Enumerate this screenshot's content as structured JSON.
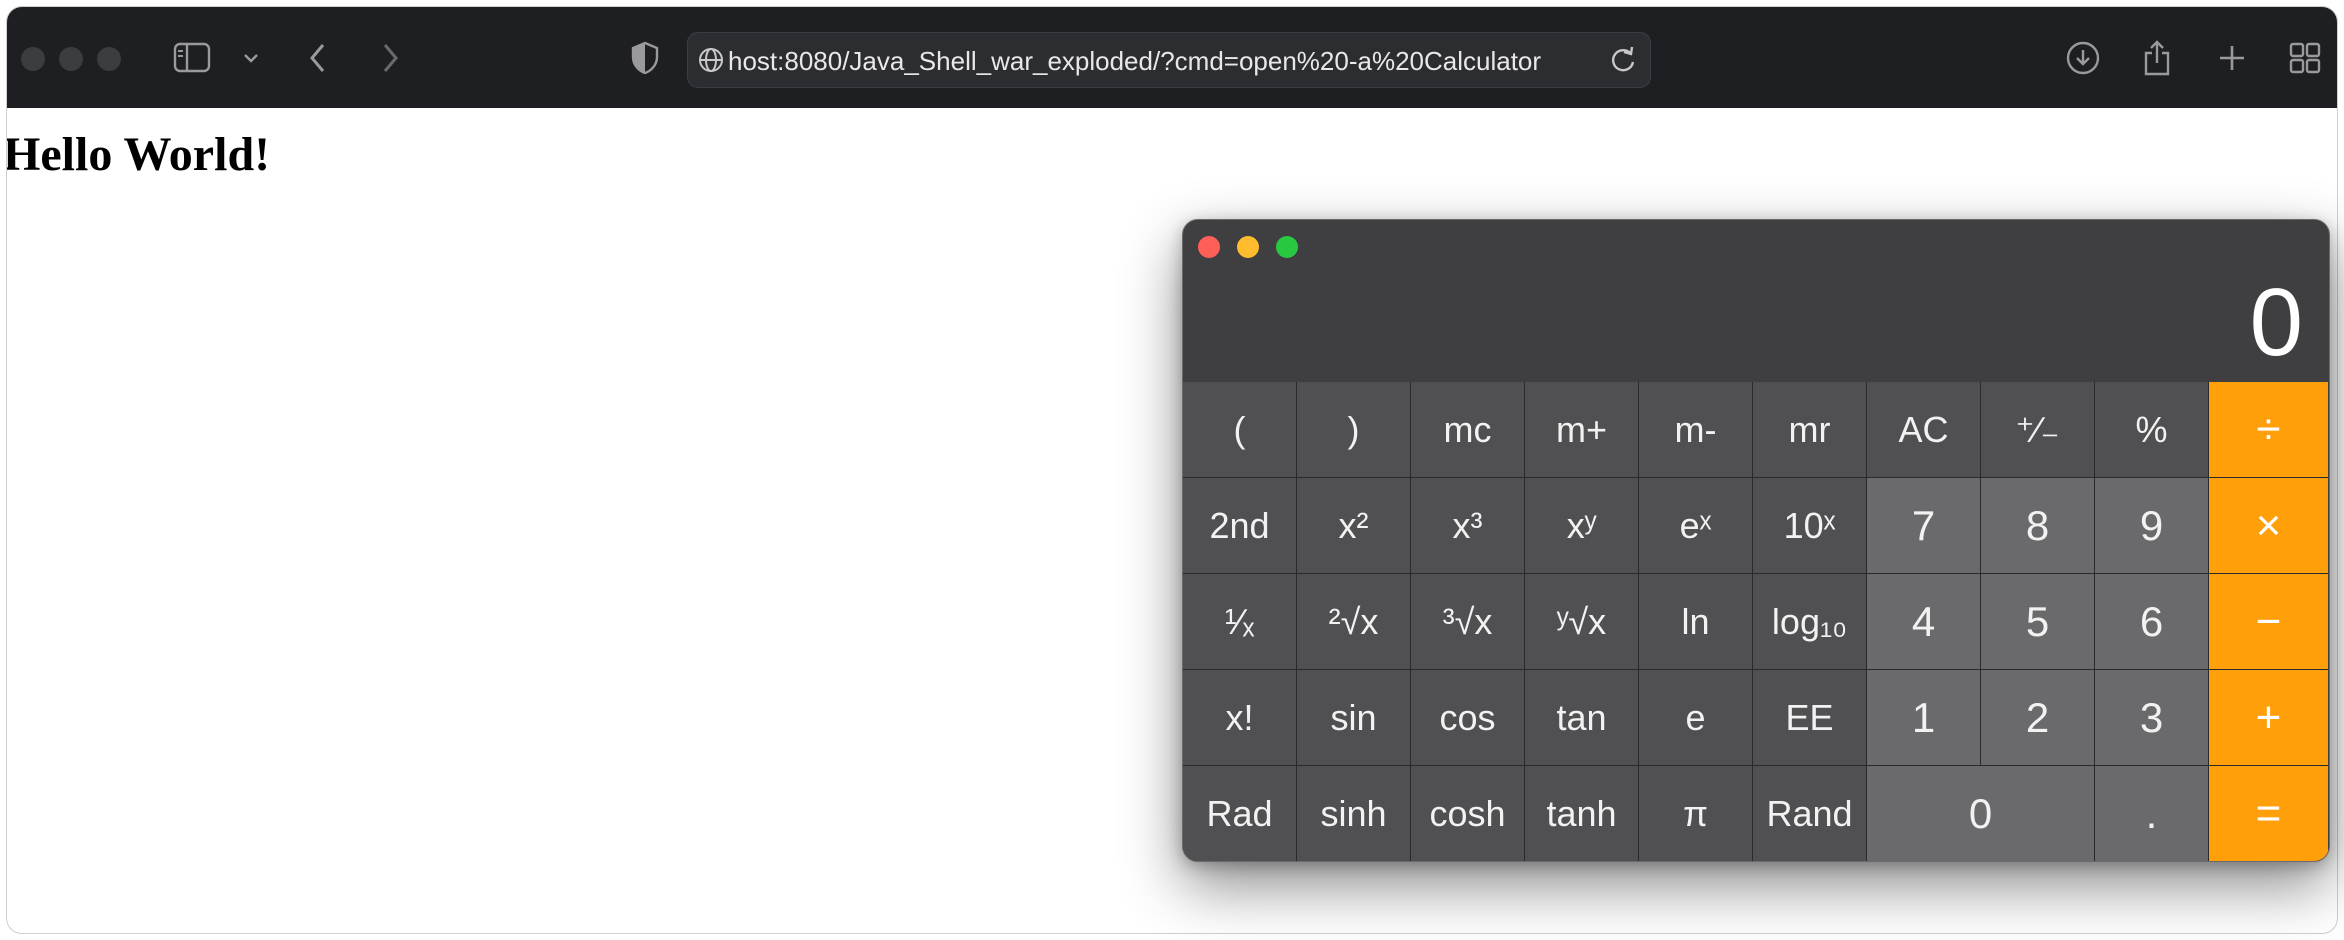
{
  "browser": {
    "url": "host:8080/Java_Shell_war_exploded/?cmd=open%20-a%20Calculator"
  },
  "page": {
    "heading": "Hello World!"
  },
  "calculator": {
    "display": "0",
    "rows": [
      [
        "(",
        ")",
        "mc",
        "m+",
        "m-",
        "mr",
        "AC",
        "⁺∕₋",
        "%",
        "÷"
      ],
      [
        "2nd",
        "x²",
        "x³",
        "xʸ",
        "eˣ",
        "10ˣ",
        "7",
        "8",
        "9",
        "×"
      ],
      [
        "¹∕ₓ",
        "²√x",
        "³√x",
        "ʸ√x",
        "ln",
        "log₁₀",
        "4",
        "5",
        "6",
        "−"
      ],
      [
        "x!",
        "sin",
        "cos",
        "tan",
        "e",
        "EE",
        "1",
        "2",
        "3",
        "+"
      ],
      [
        "Rad",
        "sinh",
        "cosh",
        "tanh",
        "π",
        "Rand",
        "0",
        ".",
        "="
      ]
    ]
  },
  "colors": {
    "toolbar_bg": "#1e1f22",
    "calc_bg": "#3f3f42",
    "key_fn": "#505053",
    "key_num": "#6a6a6c",
    "key_op": "#ff9f0a"
  }
}
